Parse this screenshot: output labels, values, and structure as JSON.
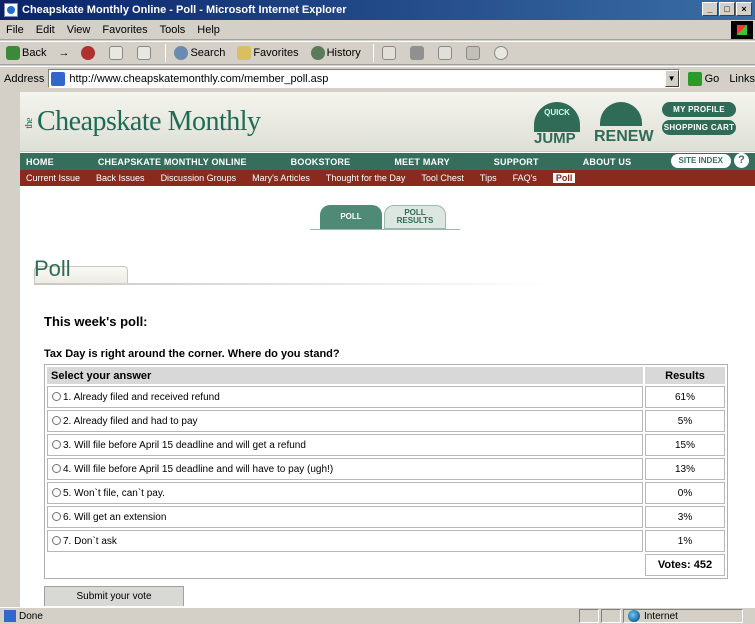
{
  "window": {
    "title": "Cheapskate Monthly Online - Poll - Microsoft Internet Explorer",
    "controls": [
      "_",
      "□",
      "×"
    ]
  },
  "menu": [
    "File",
    "Edit",
    "View",
    "Favorites",
    "Tools",
    "Help"
  ],
  "toolbar": {
    "back": "Back",
    "forward": "→",
    "search": "Search",
    "favorites": "Favorites",
    "history": "History"
  },
  "address": {
    "label": "Address",
    "url": "http://www.cheapskatemonthly.com/member_poll.asp",
    "go": "Go",
    "links": "Links"
  },
  "site": {
    "logo_the": "the",
    "logo": "Cheapskate Monthly",
    "quick_jump_top": "QUICK",
    "quick_jump": "JUMP",
    "renew": "RENEW",
    "my_profile": "MY PROFILE",
    "shopping_cart": "SHOPPING CART",
    "site_index": "SITE INDEX",
    "help": "?",
    "nav": [
      "HOME",
      "CHEAPSKATE MONTHLY ONLINE",
      "BOOKSTORE",
      "MEET MARY",
      "SUPPORT",
      "ABOUT US"
    ],
    "subnav": [
      "Current Issue",
      "Back Issues",
      "Discussion Groups",
      "Mary's Articles",
      "Thought for the Day",
      "Tool Chest",
      "Tips",
      "FAQ's",
      "Poll"
    ]
  },
  "tabs": {
    "poll": "POLL",
    "results": "POLL RESULTS"
  },
  "page": {
    "title": "Poll",
    "heading": "This week's poll:",
    "question": "Tax Day is right around the corner. Where do you stand?",
    "col_answer": "Select your answer",
    "col_results": "Results",
    "options": [
      {
        "label": "1. Already filed and received refund",
        "result": "61%"
      },
      {
        "label": "2. Already filed and had to pay",
        "result": "5%"
      },
      {
        "label": "3. Will file before April 15 deadline and will get a refund",
        "result": "15%"
      },
      {
        "label": "4. Will file before April 15 deadline and will have to pay (ugh!)",
        "result": "13%"
      },
      {
        "label": "5. Won`t file, can`t pay.",
        "result": "0%"
      },
      {
        "label": "6. Will get an extension",
        "result": "3%"
      },
      {
        "label": "7. Don`t ask",
        "result": "1%"
      }
    ],
    "votes": "Votes: 452",
    "submit": "Submit your vote"
  },
  "status": {
    "text": "Done",
    "zone": "Internet"
  }
}
